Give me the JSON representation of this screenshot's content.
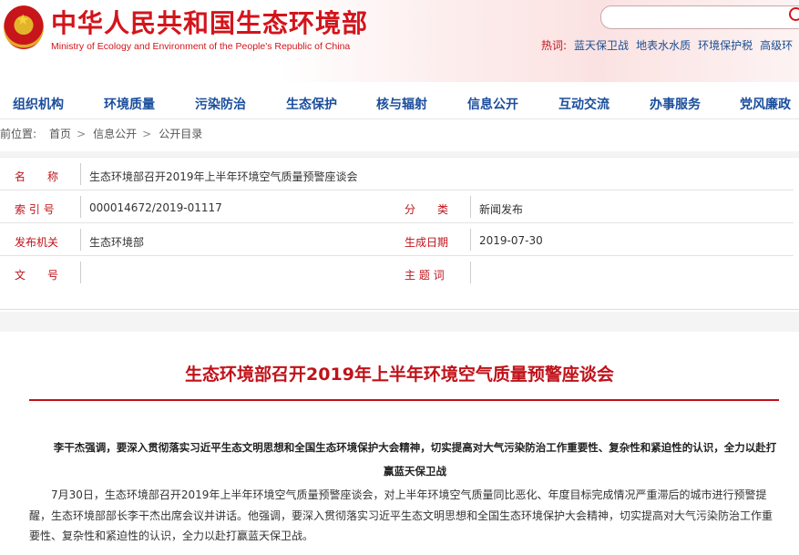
{
  "header": {
    "site_title": "中华人民共和国生态环境部",
    "site_subtitle": "Ministry of Ecology and Environment of the People's Republic of China",
    "hot_label": "热词:",
    "hot_words": [
      "蓝天保卫战",
      "地表水水质",
      "环境保护税",
      "高级环"
    ]
  },
  "nav": {
    "items": [
      "组织机构",
      "环境质量",
      "污染防治",
      "生态保护",
      "核与辐射",
      "信息公开",
      "互动交流",
      "办事服务",
      "党风廉政"
    ]
  },
  "breadcrumb": {
    "label": "当前位置:",
    "items": [
      "首页",
      "信息公开",
      "公开目录"
    ],
    "separator": ">"
  },
  "meta": {
    "name_label": "名　　称",
    "name_value": "生态环境部召开2019年上半年环境空气质量预警座谈会",
    "index_label": "索 引 号",
    "index_value": "000014672/2019-01117",
    "category_label": "分　　类",
    "category_value": "新闻发布",
    "issuer_label": "发布机关",
    "issuer_value": "生态环境部",
    "date_label": "生成日期",
    "date_value": "2019-07-30",
    "docno_label": "文　　号",
    "docno_value": "",
    "topic_label": "主 题 词",
    "topic_value": ""
  },
  "article": {
    "title": "生态环境部召开2019年上半年环境空气质量预警座谈会",
    "lead": "李干杰强调，要深入贯彻落实习近平生态文明思想和全国生态环境保护大会精神，切实提高对大气污染防治工作重要性、复杂性和紧迫性的认识，全力以赴打赢蓝天保卫战",
    "body": "7月30日，生态环境部召开2019年上半年环境空气质量预警座谈会，对上半年环境空气质量同比恶化、年度目标完成情况严重滞后的城市进行预警提醒，生态环境部部长李干杰出席会议并讲话。他强调，要深入贯彻落实习近平生态文明思想和全国生态环境保护大会精神，切实提高对大气污染防治工作重要性、复杂性和紧迫性的认识，全力以赴打赢蓝天保卫战。"
  },
  "colors": {
    "brand_red": "#d3141b",
    "nav_blue": "#1a4d9c"
  }
}
